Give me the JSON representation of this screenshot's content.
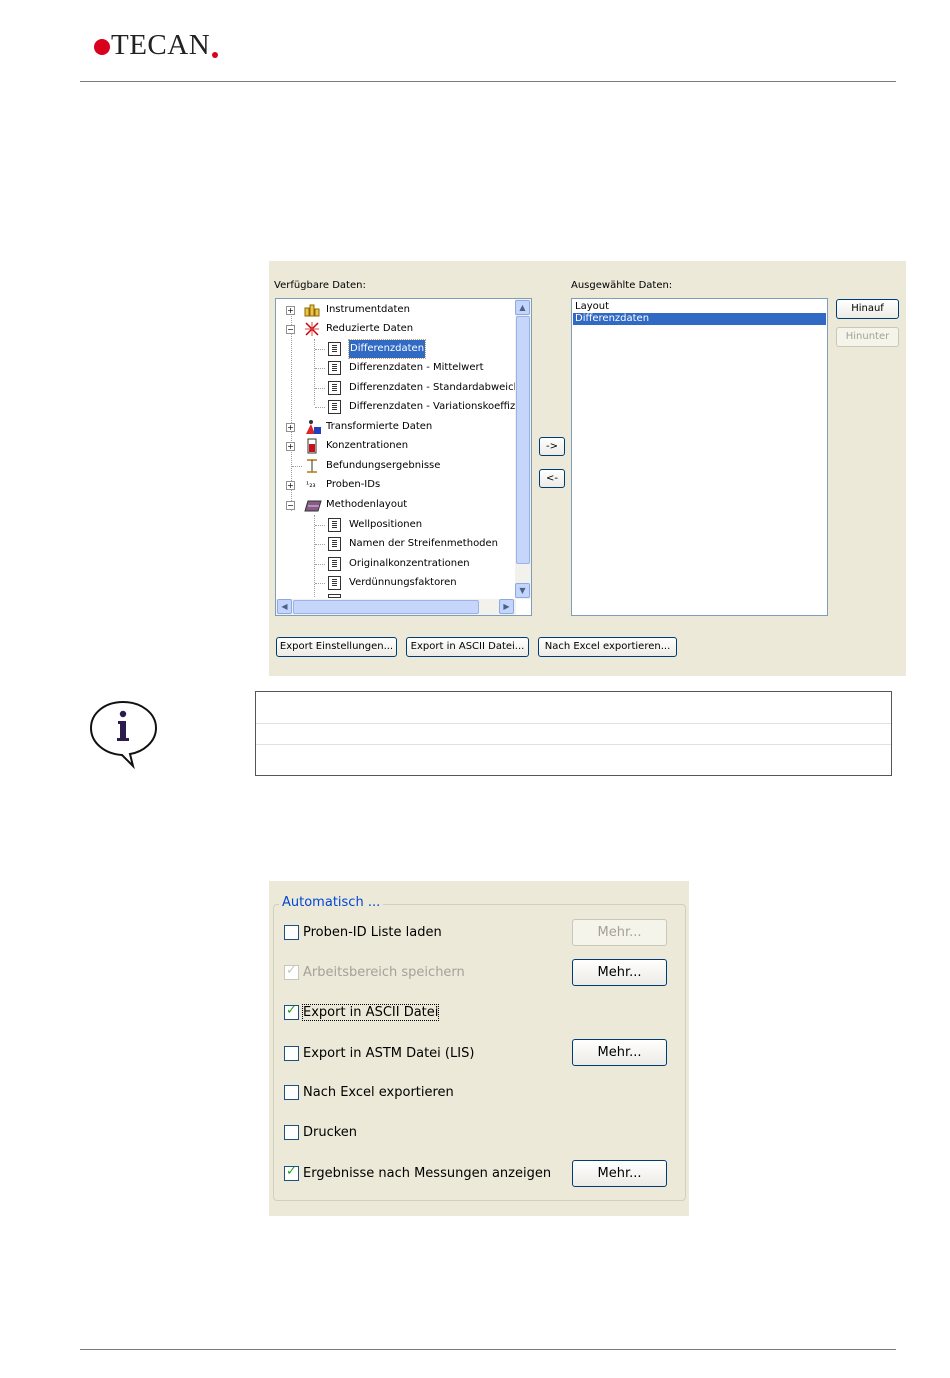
{
  "header": {
    "brand": "TECAN"
  },
  "export_dialog": {
    "available_label": "Verfügbare Daten:",
    "selected_label": "Ausgewählte Daten:",
    "tree": [
      {
        "label": "Instrumentdaten",
        "icon": "instrument-icon",
        "expander": "+"
      },
      {
        "label": "Reduzierte Daten",
        "icon": "reduced-data-icon",
        "expander": "−"
      },
      {
        "label": "Differenzdaten",
        "icon": "document-icon",
        "selected": true
      },
      {
        "label": "Differenzdaten - Mittelwert",
        "icon": "document-icon"
      },
      {
        "label": "Differenzdaten - Standardabweichu",
        "icon": "document-icon"
      },
      {
        "label": "Differenzdaten - Variationskoeffizer",
        "icon": "document-icon"
      },
      {
        "label": "Transformierte Daten",
        "icon": "transformed-data-icon",
        "expander": "+"
      },
      {
        "label": "Konzentrationen",
        "icon": "concentration-icon",
        "expander": "+"
      },
      {
        "label": "Befundungsergebnisse",
        "icon": "results-icon"
      },
      {
        "label": "Proben-IDs",
        "icon": "sample-id-icon",
        "expander": "+"
      },
      {
        "label": "Methodenlayout",
        "icon": "layout-icon",
        "expander": "−"
      },
      {
        "label": "Wellpositionen",
        "icon": "document-icon"
      },
      {
        "label": "Namen der Streifenmethoden",
        "icon": "document-icon"
      },
      {
        "label": "Originalkonzentrationen",
        "icon": "document-icon"
      },
      {
        "label": "Verdünnungsfaktoren",
        "icon": "document-icon"
      }
    ],
    "selected_items": [
      "Layout",
      "Differenzdaten"
    ],
    "add_button": "->",
    "remove_button": "<-",
    "up_button": "Hinauf",
    "down_button": "Hinunter",
    "export_settings_button": "Export Einstellungen...",
    "export_ascii_button": "Export in ASCII Datei...",
    "export_excel_button": "Nach Excel exportieren..."
  },
  "auto_dialog": {
    "group_title": "Automatisch ...",
    "options": [
      {
        "label": "Proben-ID Liste laden",
        "checked": false,
        "disabled": false,
        "mehr": "Mehr...",
        "mehr_disabled": true
      },
      {
        "label": "Arbeitsbereich speichern",
        "checked": true,
        "disabled": true,
        "mehr": "Mehr...",
        "mehr_disabled": false
      },
      {
        "label": "Export in ASCII Datei",
        "checked": true,
        "disabled": false,
        "focused": true
      },
      {
        "label": "Export in ASTM Datei (LIS)",
        "checked": false,
        "disabled": false,
        "mehr": "Mehr...",
        "mehr_disabled": false
      },
      {
        "label": "Nach Excel exportieren",
        "checked": false,
        "disabled": false
      },
      {
        "label": "Drucken",
        "checked": false,
        "disabled": false
      },
      {
        "label": "Ergebnisse nach Messungen anzeigen",
        "checked": true,
        "disabled": false,
        "mehr": "Mehr...",
        "mehr_disabled": false
      }
    ]
  },
  "colors": {
    "brand_red": "#d8001d",
    "dialog_bg": "#ece9d8",
    "selection": "#316ac5",
    "group_title": "#0046d5"
  }
}
